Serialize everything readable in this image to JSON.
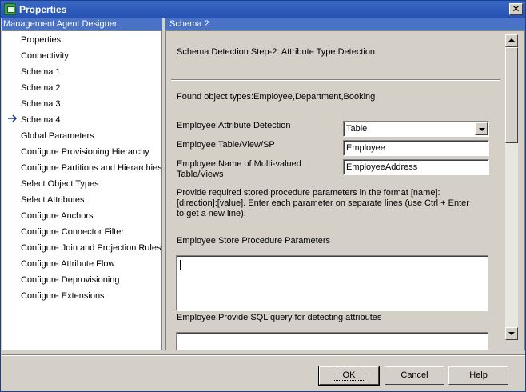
{
  "window": {
    "title": "Properties"
  },
  "left_pane": {
    "header": "Management Agent Designer",
    "items": [
      "Properties",
      "Connectivity",
      "Schema 1",
      "Schema 2",
      "Schema 3",
      "Schema 4",
      "Global Parameters",
      "Configure Provisioning Hierarchy",
      "Configure Partitions and Hierarchies",
      "Select Object Types",
      "Select Attributes",
      "Configure Anchors",
      "Configure Connector Filter",
      "Configure Join and Projection Rules",
      "Configure Attribute Flow",
      "Configure Deprovisioning",
      "Configure Extensions"
    ],
    "selected_item": "Schema 2"
  },
  "right_pane": {
    "header": "Schema 2",
    "step_title": "Schema Detection Step-2: Attribute Type Detection",
    "found_types": "Found object types:Employee,Department,Booking",
    "attribute_detection": {
      "label": "Employee:Attribute Detection",
      "value": "Table"
    },
    "table_view_sp": {
      "label": "Employee:Table/View/SP",
      "value": "Employee"
    },
    "multivalued": {
      "label_line1": "Employee:Name of Multi-valued",
      "label_line2": "Table/Views",
      "value": "EmployeeAddress"
    },
    "instructions": {
      "line1": "Provide required stored procedure parameters in the format [name]:",
      "line2": "[direction]:[value]. Enter each parameter on separate lines (use Ctrl + Enter",
      "line3": "to get a new line)."
    },
    "sp_params_label": "Employee:Store Procedure Parameters",
    "sql_query_label": "Employee:Provide SQL query for detecting attributes"
  },
  "buttons": {
    "ok": "OK",
    "cancel": "Cancel",
    "help": "Help"
  }
}
